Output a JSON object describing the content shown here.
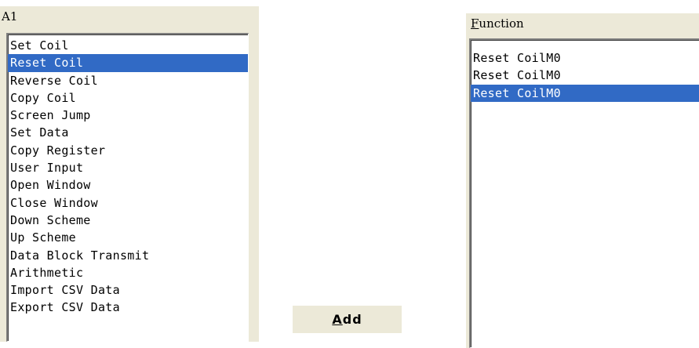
{
  "actions_group": {
    "label": "A1",
    "items": [
      "Set Coil",
      "Reset Coil",
      "Reverse Coil",
      "Copy Coil",
      "Screen Jump",
      "Set Data",
      "Copy Register",
      "User Input",
      "Open Window",
      "Close Window",
      "Down Scheme",
      "Up Scheme",
      "Data Block Transmit",
      "Arithmetic",
      "Import CSV Data",
      "Export CSV Data"
    ],
    "selected_index": 1
  },
  "add_button": {
    "mnemonic": "A",
    "rest": "dd"
  },
  "function_group": {
    "label_mnemonic": "F",
    "label_rest": "unction",
    "items": [
      "Reset CoilM0",
      "Reset CoilM0",
      "Reset CoilM0"
    ],
    "selected_index": 2
  },
  "colors": {
    "panel_bg": "#ece9d8",
    "selection_bg": "#316ac5",
    "selection_text": "#ffffff"
  }
}
